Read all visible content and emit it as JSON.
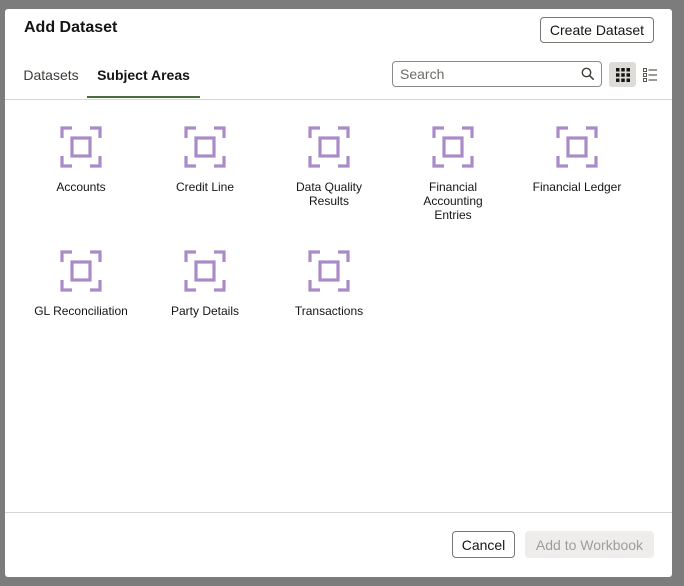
{
  "dialog": {
    "title": "Add Dataset",
    "create_button": "Create Dataset"
  },
  "tabs": [
    {
      "label": "Datasets",
      "active": false
    },
    {
      "label": "Subject Areas",
      "active": true
    }
  ],
  "search": {
    "placeholder": "Search",
    "value": ""
  },
  "view_toggle": {
    "selected": "grid",
    "icons": [
      "grid-view-icon",
      "list-view-icon"
    ]
  },
  "subject_areas": [
    {
      "label": "Accounts"
    },
    {
      "label": "Credit Line"
    },
    {
      "label": "Data Quality Results"
    },
    {
      "label": "Financial Accounting Entries"
    },
    {
      "label": "Financial Ledger"
    },
    {
      "label": "GL Reconciliation"
    },
    {
      "label": "Party Details"
    },
    {
      "label": "Transactions"
    }
  ],
  "footer": {
    "cancel_label": "Cancel",
    "add_label": "Add to Workbook",
    "add_enabled": false
  },
  "colors": {
    "icon_accent": "#a98bc7",
    "tab_underline": "#4b6d3b"
  }
}
